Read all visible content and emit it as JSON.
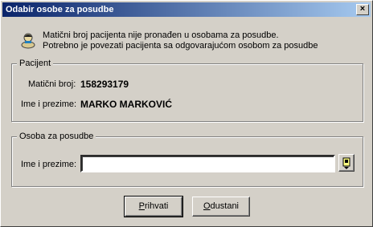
{
  "window": {
    "title": "Odabir osobe za posudbe",
    "close_glyph": "×"
  },
  "message": {
    "icon": "info-person-icon",
    "line1": "Matični broj pacijenta nije pronađen u osobama za posudbe.",
    "line2": "Potrebno je povezati pacijenta sa odgovarajućom osobom za posudbe"
  },
  "patient_group": {
    "legend": "Pacijent",
    "id_label": "Matični broj:",
    "id_value": "158293179",
    "name_label": "Ime i prezime:",
    "name_value": "MARKO MARKOVIĆ"
  },
  "person_group": {
    "legend": "Osoba za posudbe",
    "name_label": "Ime i prezime:",
    "name_value": "",
    "lookup_icon": "lookup-icon"
  },
  "buttons": {
    "accept_label_first": "P",
    "accept_label_rest": "rihvati",
    "cancel_label_first": "O",
    "cancel_label_rest": "dustani"
  }
}
